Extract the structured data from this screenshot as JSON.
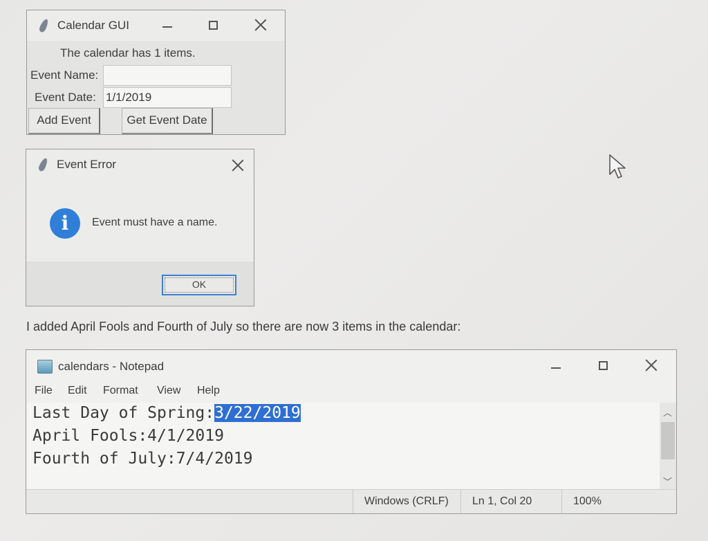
{
  "calendar_gui": {
    "title": "Calendar GUI",
    "status": "The calendar has 1 items.",
    "event_name_label": "Event Name:",
    "event_name_value": "",
    "event_date_label": "Event Date:",
    "event_date_value": "1/1/2019",
    "add_event_label": "Add Event",
    "get_event_date_label": "Get Event Date"
  },
  "error_dialog": {
    "title": "Event Error",
    "message": "Event must have a name.",
    "ok_label": "OK",
    "icon": "info-icon"
  },
  "caption": "I added April Fools and Fourth of July so there are now 3 items in the calendar:",
  "notepad": {
    "title": "calendars - Notepad",
    "menu": [
      "File",
      "Edit",
      "Format",
      "View",
      "Help"
    ],
    "lines": [
      {
        "prefix": "Last Day of Spring:",
        "selected": "3/22/2019"
      },
      {
        "prefix": "April Fools:4/1/2019",
        "selected": ""
      },
      {
        "prefix": "Fourth of July:7/4/2019",
        "selected": ""
      }
    ],
    "status": {
      "line_endings": "Windows (CRLF)",
      "position": "Ln 1, Col 20",
      "zoom": "100%"
    }
  },
  "colors": {
    "selection": "#2f6fd2",
    "info_icon": "#2f7fd8",
    "ok_border": "#3d7fd4"
  }
}
